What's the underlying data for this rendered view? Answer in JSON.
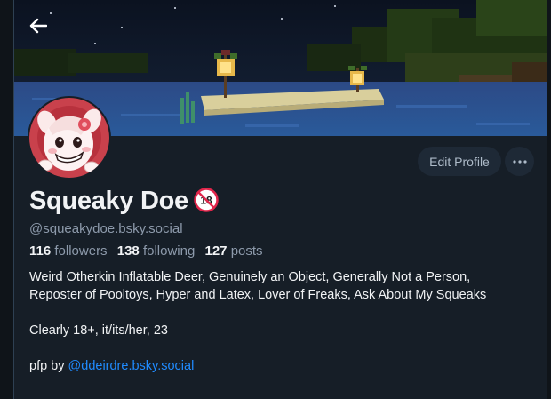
{
  "header": {
    "back_icon": "arrow-left-icon"
  },
  "profile": {
    "display_name": "Squeaky Doe",
    "badge_icon": "no-under-18-icon",
    "badge_text": "18",
    "handle": "@squeakydoe.bsky.social",
    "avatar_icon": "deer-avatar",
    "banner_description": "",
    "stats": {
      "followers_count": "116",
      "followers_label": "followers",
      "following_count": "138",
      "following_label": "following",
      "posts_count": "127",
      "posts_label": "posts"
    },
    "bio": {
      "line1": "Weird Otherkin Inflatable Deer, Genuinely an Object, Generally Not a Person,",
      "line2": "Reposter of Pooltoys, Hyper and Latex, Lover of Freaks, Ask About My Squeaks",
      "line3": "Clearly 18+, it/its/her, 23",
      "line4_prefix": "pfp by ",
      "line4_link": "@ddeirdre.bsky.social"
    }
  },
  "actions": {
    "edit_profile_label": "Edit Profile",
    "more_icon": "ellipsis-icon"
  },
  "colors": {
    "background": "#161e27",
    "button_bg": "#1e2936",
    "text_primary": "#f1f3f5",
    "text_secondary": "#8d9aab",
    "link": "#208bfe",
    "badge_red": "#e0254a"
  }
}
